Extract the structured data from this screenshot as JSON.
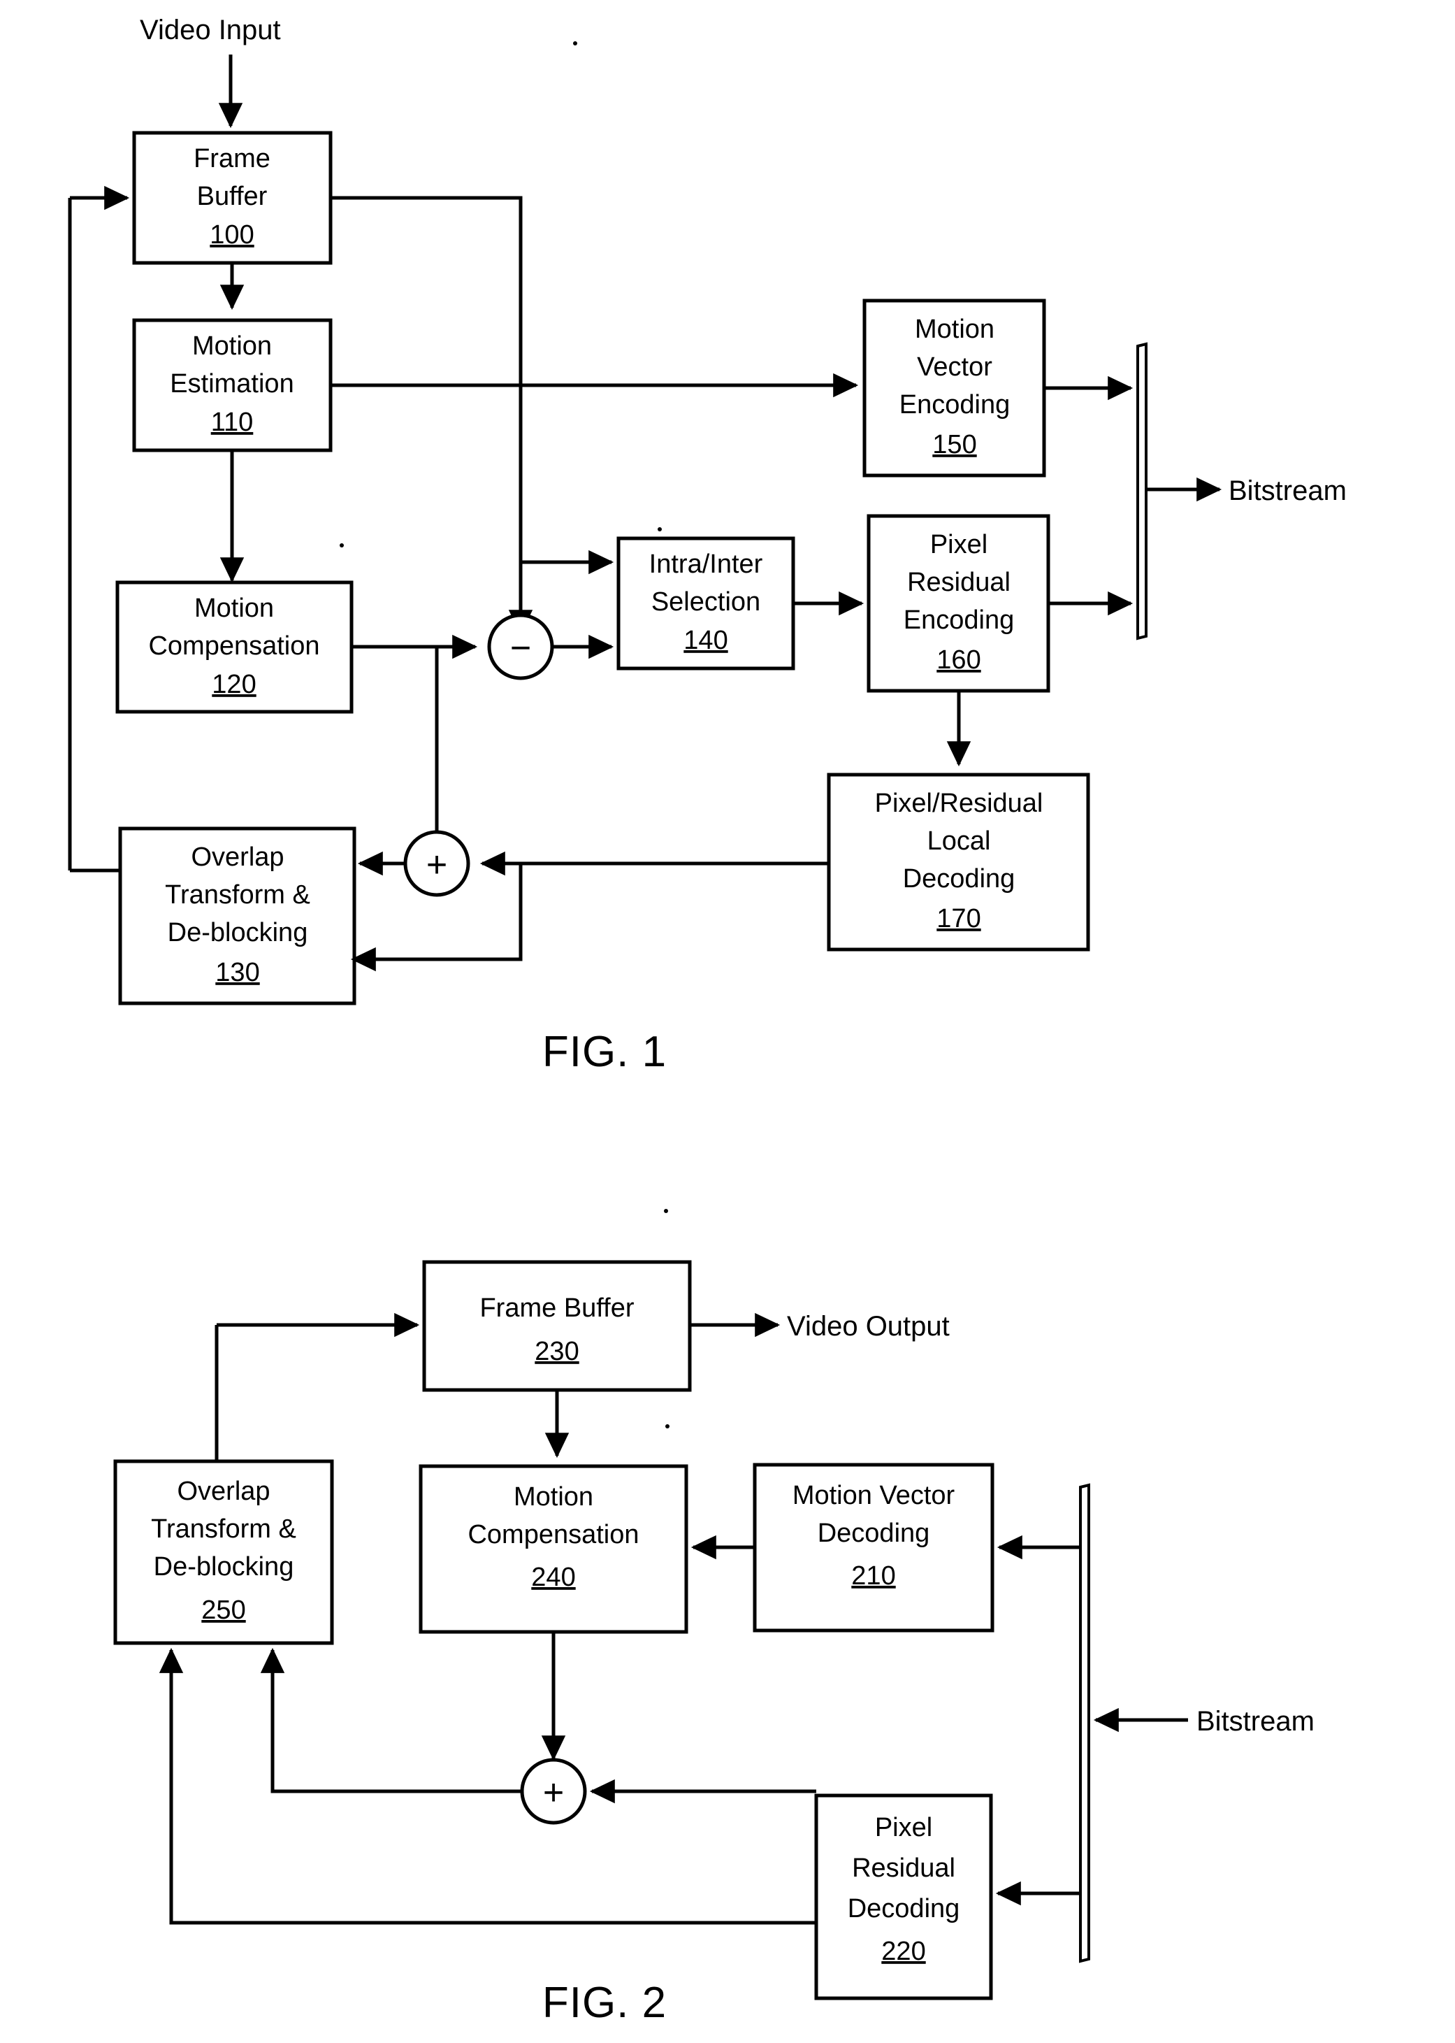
{
  "document": {
    "type": "patent-figure-sheet",
    "figures": [
      {
        "caption": "FIG. 1",
        "title": "Video encoder block diagram",
        "io_labels": [
          {
            "name": "video-input",
            "text": "Video Input"
          },
          {
            "name": "bitstream-out",
            "text": "Bitstream"
          }
        ],
        "operators": [
          {
            "name": "subtract-node",
            "symbol": "−"
          },
          {
            "name": "sum-node",
            "symbol": "+"
          }
        ],
        "blocks": [
          {
            "id": "100",
            "lines": [
              "Frame",
              "Buffer"
            ],
            "num": "100"
          },
          {
            "id": "110",
            "lines": [
              "Motion",
              "Estimation"
            ],
            "num": "110"
          },
          {
            "id": "120",
            "lines": [
              "Motion",
              "Compensation"
            ],
            "num": "120"
          },
          {
            "id": "130",
            "lines": [
              "Overlap",
              "Transform &",
              "De-blocking"
            ],
            "num": "130"
          },
          {
            "id": "140",
            "lines": [
              "Intra/Inter",
              "Selection"
            ],
            "num": "140"
          },
          {
            "id": "150",
            "lines": [
              "Motion",
              "Vector",
              "Encoding"
            ],
            "num": "150"
          },
          {
            "id": "160",
            "lines": [
              "Pixel",
              "Residual",
              "Encoding"
            ],
            "num": "160"
          },
          {
            "id": "170",
            "lines": [
              "Pixel/Residual",
              "Local",
              "Decoding"
            ],
            "num": "170"
          }
        ]
      },
      {
        "caption": "FIG. 2",
        "title": "Video decoder block diagram",
        "io_labels": [
          {
            "name": "video-output",
            "text": "Video Output"
          },
          {
            "name": "bitstream-in",
            "text": "Bitstream"
          }
        ],
        "operators": [
          {
            "name": "sum-node",
            "symbol": "+"
          }
        ],
        "blocks": [
          {
            "id": "230",
            "lines": [
              "Frame Buffer"
            ],
            "num": "230"
          },
          {
            "id": "250",
            "lines": [
              "Overlap",
              "Transform &",
              "De-blocking"
            ],
            "num": "250"
          },
          {
            "id": "240",
            "lines": [
              "Motion",
              "Compensation"
            ],
            "num": "240"
          },
          {
            "id": "210",
            "lines": [
              "Motion Vector",
              "Decoding"
            ],
            "num": "210"
          },
          {
            "id": "220",
            "lines": [
              "Pixel",
              "Residual",
              "Decoding"
            ],
            "num": "220"
          }
        ]
      }
    ]
  },
  "fig1": {
    "video_input": "Video Input",
    "bitstream": "Bitstream",
    "minus": "−",
    "plus": "+",
    "caption": "FIG. 1",
    "b100": {
      "l1": "Frame",
      "l2": "Buffer",
      "num": "100"
    },
    "b110": {
      "l1": "Motion",
      "l2": "Estimation",
      "num": "110"
    },
    "b120": {
      "l1": "Motion",
      "l2": "Compensation",
      "num": "120"
    },
    "b130": {
      "l1": "Overlap",
      "l2": "Transform &",
      "l3": "De-blocking",
      "num": "130"
    },
    "b140": {
      "l1": "Intra/Inter",
      "l2": "Selection",
      "num": "140"
    },
    "b150": {
      "l1": "Motion",
      "l2": "Vector",
      "l3": "Encoding",
      "num": "150"
    },
    "b160": {
      "l1": "Pixel",
      "l2": "Residual",
      "l3": "Encoding",
      "num": "160"
    },
    "b170": {
      "l1": "Pixel/Residual",
      "l2": "Local",
      "l3": "Decoding",
      "num": "170"
    }
  },
  "fig2": {
    "video_output": "Video Output",
    "bitstream": "Bitstream",
    "plus": "+",
    "caption": "FIG. 2",
    "b230": {
      "l1": "Frame Buffer",
      "num": "230"
    },
    "b250": {
      "l1": "Overlap",
      "l2": "Transform &",
      "l3": "De-blocking",
      "num": "250"
    },
    "b240": {
      "l1": "Motion",
      "l2": "Compensation",
      "num": "240"
    },
    "b210": {
      "l1": "Motion Vector",
      "l2": "Decoding",
      "num": "210"
    },
    "b220": {
      "l1": "Pixel",
      "l2": "Residual",
      "l3": "Decoding",
      "num": "220"
    }
  }
}
